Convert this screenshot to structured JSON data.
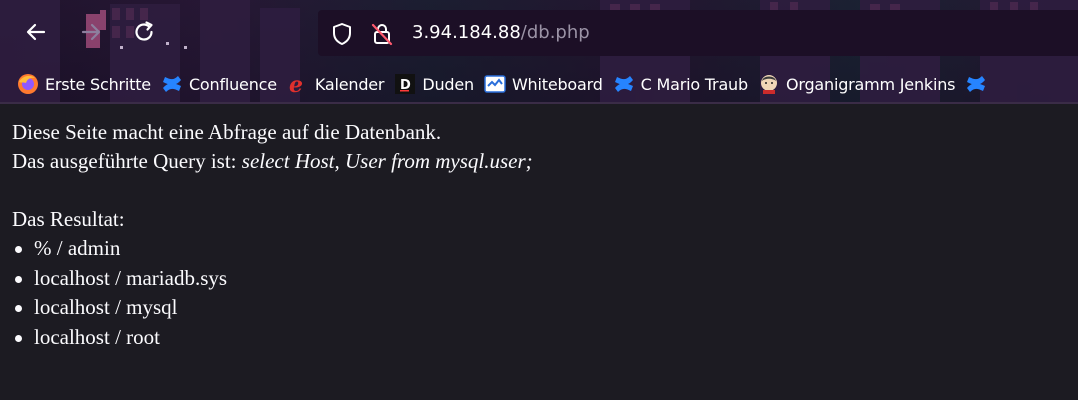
{
  "browser": {
    "url_host": "3.94.184.88",
    "url_path": "/db.php",
    "bookmarks": [
      {
        "label": "Erste Schritte",
        "icon": "firefox-icon"
      },
      {
        "label": "Confluence",
        "icon": "confluence-icon"
      },
      {
        "label": "Kalender",
        "icon": "kalender-icon"
      },
      {
        "label": "Duden",
        "icon": "duden-icon"
      },
      {
        "label": "Whiteboard",
        "icon": "whiteboard-icon"
      },
      {
        "label": "C Mario Traub",
        "icon": "confluence-icon"
      },
      {
        "label": "Organigramm Jenkins",
        "icon": "jenkins-icon"
      },
      {
        "label": "",
        "icon": "confluence-icon"
      }
    ],
    "colors": {
      "url_host": "#ffffff",
      "url_path": "#9b93a6",
      "page_background": "#1c1b22",
      "page_text": "#fbfbfe"
    }
  },
  "page": {
    "intro": "Diese Seite macht eine Abfrage auf die Datenbank.",
    "query_label": "Das ausgeführte Query ist: ",
    "query": "select Host, User from mysql.user;",
    "result_heading": "Das Resultat:",
    "results": [
      "% / admin",
      "localhost / mariadb.sys",
      "localhost / mysql",
      "localhost / root"
    ]
  }
}
